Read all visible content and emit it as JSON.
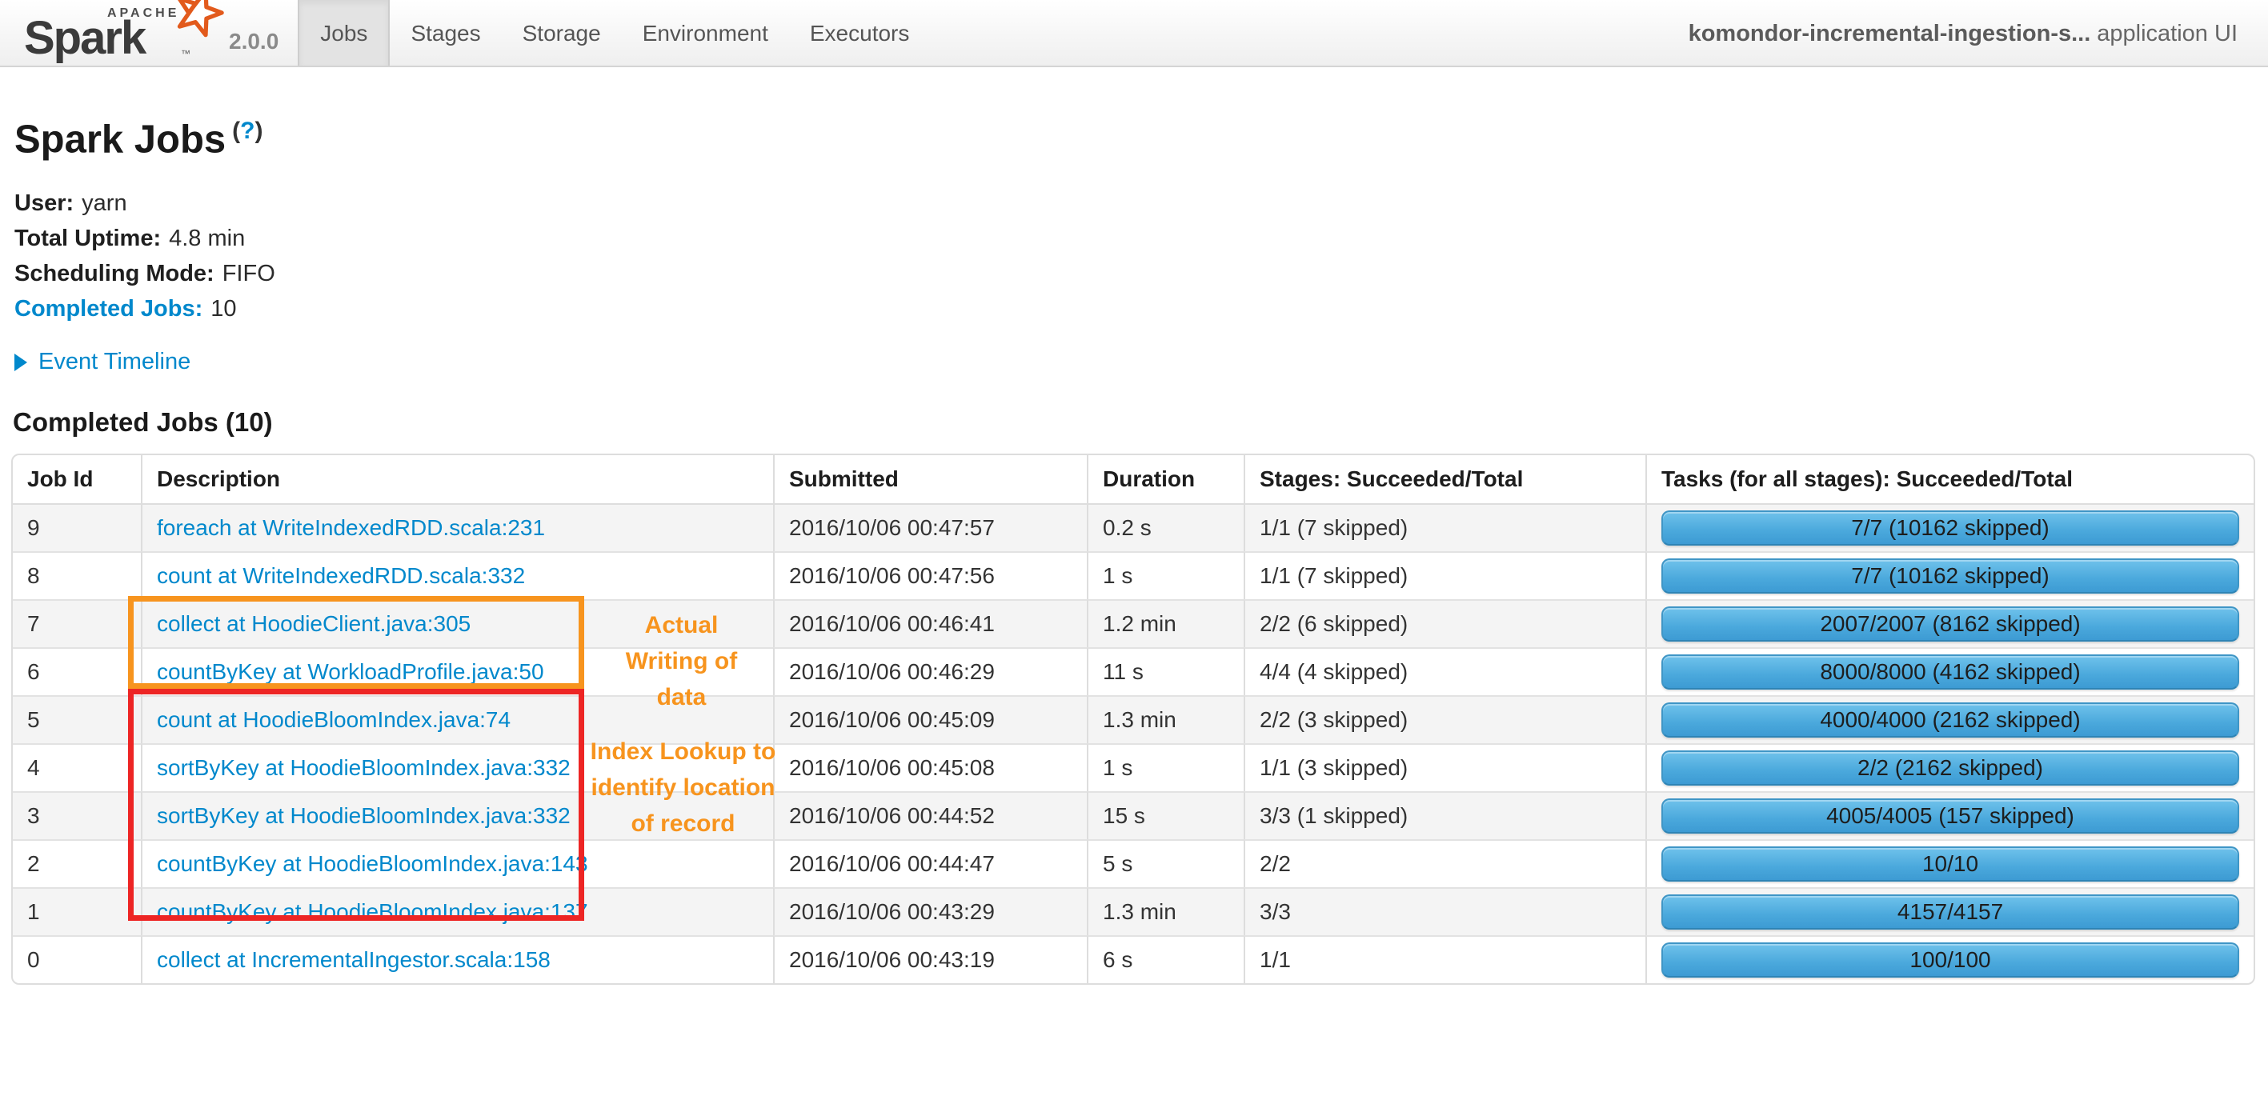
{
  "header": {
    "brand": {
      "apache": "APACHE",
      "name": "Spark",
      "tm": "™",
      "version": "2.0.0"
    },
    "nav": [
      {
        "label": "Jobs"
      },
      {
        "label": "Stages"
      },
      {
        "label": "Storage"
      },
      {
        "label": "Environment"
      },
      {
        "label": "Executors"
      }
    ],
    "app_name": "komondor-incremental-ingestion-s...",
    "app_suffix": "application UI"
  },
  "page": {
    "title": "Spark Jobs",
    "help_open": "(",
    "help_q": "?",
    "help_close": ")",
    "info": [
      {
        "label": "User:",
        "value": "yarn"
      },
      {
        "label": "Total Uptime:",
        "value": "4.8 min"
      },
      {
        "label": "Scheduling Mode:",
        "value": "FIFO"
      },
      {
        "label": "Completed Jobs:",
        "value": "10"
      }
    ],
    "event_timeline_label": "Event Timeline",
    "section_heading": "Completed Jobs (10)"
  },
  "table": {
    "headers": [
      "Job Id",
      "Description",
      "Submitted",
      "Duration",
      "Stages: Succeeded/Total",
      "Tasks (for all stages): Succeeded/Total"
    ],
    "rows": [
      {
        "id": "9",
        "desc": "foreach at WriteIndexedRDD.scala:231",
        "submitted": "2016/10/06 00:47:57",
        "duration": "0.2 s",
        "stages": "1/1 (7 skipped)",
        "tasks": "7/7 (10162 skipped)"
      },
      {
        "id": "8",
        "desc": "count at WriteIndexedRDD.scala:332",
        "submitted": "2016/10/06 00:47:56",
        "duration": "1 s",
        "stages": "1/1 (7 skipped)",
        "tasks": "7/7 (10162 skipped)"
      },
      {
        "id": "7",
        "desc": "collect at HoodieClient.java:305",
        "submitted": "2016/10/06 00:46:41",
        "duration": "1.2 min",
        "stages": "2/2 (6 skipped)",
        "tasks": "2007/2007 (8162 skipped)"
      },
      {
        "id": "6",
        "desc": "countByKey at WorkloadProfile.java:50",
        "submitted": "2016/10/06 00:46:29",
        "duration": "11 s",
        "stages": "4/4 (4 skipped)",
        "tasks": "8000/8000 (4162 skipped)"
      },
      {
        "id": "5",
        "desc": "count at HoodieBloomIndex.java:74",
        "submitted": "2016/10/06 00:45:09",
        "duration": "1.3 min",
        "stages": "2/2 (3 skipped)",
        "tasks": "4000/4000 (2162 skipped)"
      },
      {
        "id": "4",
        "desc": "sortByKey at HoodieBloomIndex.java:332",
        "submitted": "2016/10/06 00:45:08",
        "duration": "1 s",
        "stages": "1/1 (3 skipped)",
        "tasks": "2/2 (2162 skipped)"
      },
      {
        "id": "3",
        "desc": "sortByKey at HoodieBloomIndex.java:332",
        "submitted": "2016/10/06 00:44:52",
        "duration": "15 s",
        "stages": "3/3 (1 skipped)",
        "tasks": "4005/4005 (157 skipped)"
      },
      {
        "id": "2",
        "desc": "countByKey at HoodieBloomIndex.java:143",
        "submitted": "2016/10/06 00:44:47",
        "duration": "5 s",
        "stages": "2/2",
        "tasks": "10/10"
      },
      {
        "id": "1",
        "desc": "countByKey at HoodieBloomIndex.java:137",
        "submitted": "2016/10/06 00:43:29",
        "duration": "1.3 min",
        "stages": "3/3",
        "tasks": "4157/4157"
      },
      {
        "id": "0",
        "desc": "collect at IncrementalIngestor.scala:158",
        "submitted": "2016/10/06 00:43:19",
        "duration": "6 s",
        "stages": "1/1",
        "tasks": "100/100"
      }
    ]
  },
  "annotations": {
    "writing_label": "Actual Writing of data",
    "index_label": "Index Lookup to identify location of record"
  },
  "colors": {
    "accent_blue": "#0088cc",
    "bar_blue": "#4aa8dc",
    "annotation_orange": "#f7941e",
    "annotation_red": "#ed2524"
  }
}
